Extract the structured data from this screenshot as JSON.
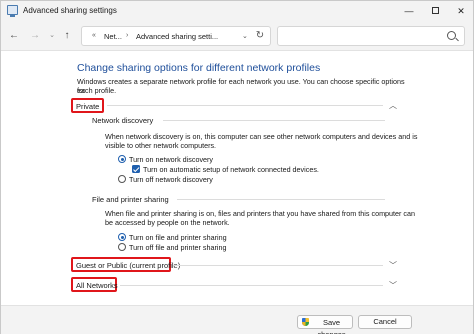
{
  "window": {
    "title": "Advanced sharing settings",
    "controls": {
      "minimize": "—",
      "close": "✕"
    }
  },
  "nav": {
    "back": "←",
    "forward": "→",
    "dropdown": "⌄",
    "up": "↑",
    "address": {
      "crumbs": [
        "Net...",
        "Advanced sharing setti..."
      ]
    },
    "refresh": "↻",
    "search_placeholder": ""
  },
  "main": {
    "heading": "Change sharing options for different network profiles",
    "description_line1": "Windows creates a separate network profile for each network you use. You can choose specific options for",
    "description_line2": "each profile.",
    "sections": {
      "private": {
        "label": "Private",
        "expanded": true,
        "network_discovery": {
          "label": "Network discovery",
          "desc_line1": "When network discovery is on, this computer can see other network computers and devices and is",
          "desc_line2": "visible to other network computers.",
          "option_on": "Turn on network discovery",
          "auto_setup": "Turn on automatic setup of network connected devices.",
          "option_off": "Turn off network discovery",
          "selected": "on",
          "auto_setup_checked": true
        },
        "file_printer": {
          "label": "File and printer sharing",
          "desc_line1": "When file and printer sharing is on, files and printers that you have shared from this computer can",
          "desc_line2": "be accessed by people on the network.",
          "option_on": "Turn on file and printer sharing",
          "option_off": "Turn off file and printer sharing",
          "selected": "on"
        }
      },
      "guest_public": {
        "label": "Guest or Public (current profile)",
        "expanded": false
      },
      "all_networks": {
        "label": "All Networks",
        "expanded": false
      }
    }
  },
  "footer": {
    "save_label": "Save changes",
    "cancel_label": "Cancel"
  },
  "colors": {
    "heading": "#1e4e9a",
    "accent": "#1f5fae",
    "highlight": "#e0161b"
  }
}
